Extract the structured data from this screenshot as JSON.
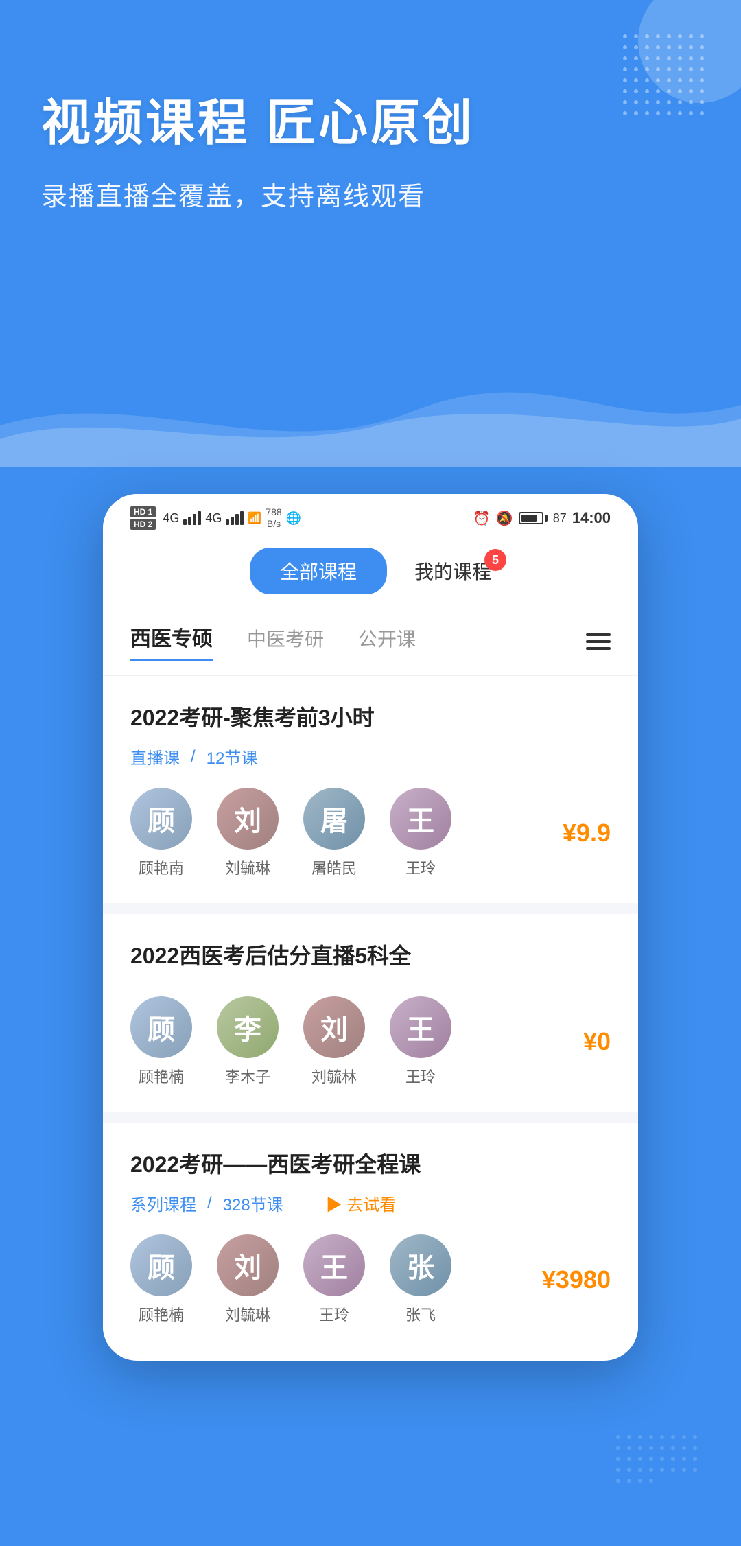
{
  "hero": {
    "title": "视频课程 匠心原创",
    "subtitle": "录播直播全覆盖，支持离线观看"
  },
  "status_bar": {
    "hd1": "HD1",
    "hd2": "HD2",
    "network_speed": "788\nB/s",
    "time": "14:00",
    "battery_percent": "87"
  },
  "tabs": {
    "all_courses": "全部课程",
    "my_courses": "我的课程",
    "badge": "5"
  },
  "categories": [
    {
      "label": "西医专硕",
      "active": true
    },
    {
      "label": "中医考研",
      "active": false
    },
    {
      "label": "公开课",
      "active": false
    }
  ],
  "courses": [
    {
      "title": "2022考研-聚焦考前3小时",
      "type": "直播课",
      "lessons": "12节课",
      "price": "¥9.9",
      "teachers": [
        {
          "name": "顾艳南",
          "avatar_class": "av1",
          "initial": "顾"
        },
        {
          "name": "刘毓琳",
          "avatar_class": "av2",
          "initial": "刘"
        },
        {
          "name": "屠皓民",
          "avatar_class": "av3",
          "initial": "屠"
        },
        {
          "name": "王玲",
          "avatar_class": "av4",
          "initial": "王"
        }
      ]
    },
    {
      "title": "2022西医考后估分直播5科全",
      "type": "",
      "lessons": "",
      "price": "¥0",
      "teachers": [
        {
          "name": "顾艳楠",
          "avatar_class": "av1",
          "initial": "顾"
        },
        {
          "name": "李木子",
          "avatar_class": "av5",
          "initial": "李"
        },
        {
          "name": "刘毓林",
          "avatar_class": "av2",
          "initial": "刘"
        },
        {
          "name": "王玲",
          "avatar_class": "av4",
          "initial": "王"
        }
      ]
    },
    {
      "title": "2022考研——西医考研全程课",
      "type": "系列课程",
      "lessons": "328节课",
      "try_watch": "▶ 去试看",
      "price": "¥3980",
      "teachers": [
        {
          "name": "顾艳楠",
          "avatar_class": "av1",
          "initial": "顾"
        },
        {
          "name": "刘毓琳",
          "avatar_class": "av2",
          "initial": "刘"
        },
        {
          "name": "王玲",
          "avatar_class": "av4",
          "initial": "王"
        },
        {
          "name": "张飞",
          "avatar_class": "av3",
          "initial": "张"
        }
      ]
    }
  ]
}
